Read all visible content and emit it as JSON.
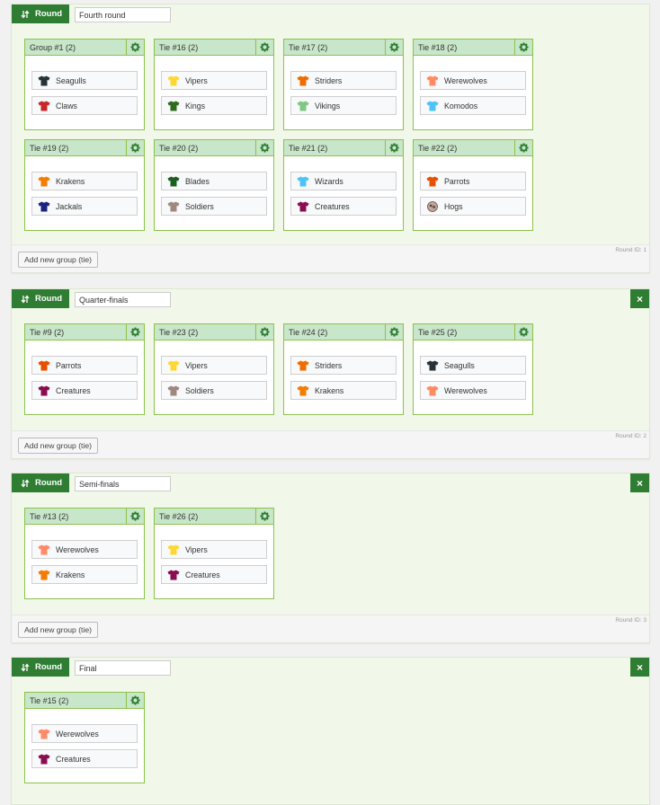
{
  "labels": {
    "round_badge": "Round",
    "close": "×",
    "add_group": "Add new group (tie)"
  },
  "colors": {
    "accent": "#2e7d32",
    "tie_header": "#c8e6c9",
    "tie_border": "#8bc34a",
    "round_bg": "#f1f8e9"
  },
  "rounds": [
    {
      "name": "Fourth round",
      "round_id": "Round ID: 1",
      "ties": [
        {
          "title": "Group #1 (2)",
          "teams": [
            {
              "name": "Seagulls",
              "color": "#263238"
            },
            {
              "name": "Claws",
              "color": "#c62828"
            }
          ]
        },
        {
          "title": "Tie #16 (2)",
          "teams": [
            {
              "name": "Vipers",
              "color": "#fdd835"
            },
            {
              "name": "Kings",
              "color": "#2e6b1f"
            }
          ]
        },
        {
          "title": "Tie #17 (2)",
          "teams": [
            {
              "name": "Striders",
              "color": "#ef6c00"
            },
            {
              "name": "Vikings",
              "color": "#81c784"
            }
          ]
        },
        {
          "title": "Tie #18 (2)",
          "teams": [
            {
              "name": "Werewolves",
              "color": "#ff8a65"
            },
            {
              "name": "Komodos",
              "color": "#4fc3f7"
            }
          ]
        },
        {
          "title": "Tie #19 (2)",
          "teams": [
            {
              "name": "Krakens",
              "color": "#f57c00"
            },
            {
              "name": "Jackals",
              "color": "#1a237e"
            }
          ]
        },
        {
          "title": "Tie #20 (2)",
          "teams": [
            {
              "name": "Blades",
              "color": "#1b5e20"
            },
            {
              "name": "Soldiers",
              "color": "#a1887f"
            }
          ]
        },
        {
          "title": "Tie #21 (2)",
          "teams": [
            {
              "name": "Wizards",
              "color": "#4fc3f7"
            },
            {
              "name": "Creatures",
              "color": "#880e4f"
            }
          ]
        },
        {
          "title": "Tie #22 (2)",
          "teams": [
            {
              "name": "Parrots",
              "color": "#e65100"
            },
            {
              "name": "Hogs",
              "color": "#8d6e63",
              "icon": "hog-logo-icon"
            }
          ]
        }
      ]
    },
    {
      "name": "Quarter-finals",
      "round_id": "Round ID: 2",
      "ties": [
        {
          "title": "Tie #9 (2)",
          "teams": [
            {
              "name": "Parrots",
              "color": "#e65100"
            },
            {
              "name": "Creatures",
              "color": "#880e4f"
            }
          ]
        },
        {
          "title": "Tie #23 (2)",
          "teams": [
            {
              "name": "Vipers",
              "color": "#fdd835"
            },
            {
              "name": "Soldiers",
              "color": "#a1887f"
            }
          ]
        },
        {
          "title": "Tie #24 (2)",
          "teams": [
            {
              "name": "Striders",
              "color": "#ef6c00"
            },
            {
              "name": "Krakens",
              "color": "#f57c00"
            }
          ]
        },
        {
          "title": "Tie #25 (2)",
          "teams": [
            {
              "name": "Seagulls",
              "color": "#263238"
            },
            {
              "name": "Werewolves",
              "color": "#ff8a65"
            }
          ]
        }
      ]
    },
    {
      "name": "Semi-finals",
      "round_id": "Round ID: 3",
      "ties": [
        {
          "title": "Tie #13 (2)",
          "teams": [
            {
              "name": "Werewolves",
              "color": "#ff8a65"
            },
            {
              "name": "Krakens",
              "color": "#f57c00"
            }
          ]
        },
        {
          "title": "Tie #26 (2)",
          "teams": [
            {
              "name": "Vipers",
              "color": "#fdd835"
            },
            {
              "name": "Creatures",
              "color": "#880e4f"
            }
          ]
        }
      ]
    },
    {
      "name": "Final",
      "round_id": "",
      "ties": [
        {
          "title": "Tie #15 (2)",
          "teams": [
            {
              "name": "Werewolves",
              "color": "#ff8a65"
            },
            {
              "name": "Creatures",
              "color": "#880e4f"
            }
          ]
        }
      ]
    }
  ]
}
